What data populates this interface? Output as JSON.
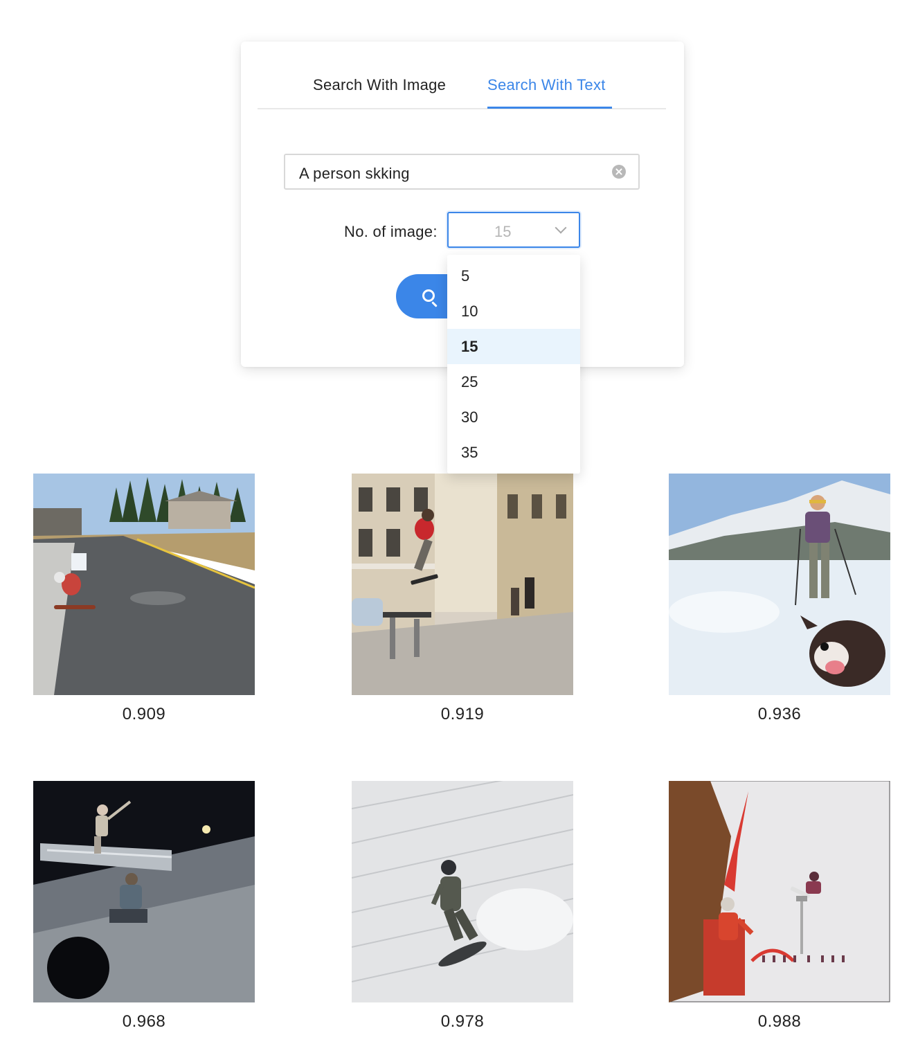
{
  "tabs": [
    {
      "label": "Search With Image",
      "active": false
    },
    {
      "label": "Search With Text",
      "active": true
    }
  ],
  "search": {
    "value": "A person skking"
  },
  "image_count": {
    "label": "No. of image:",
    "selected": "15",
    "options": [
      "5",
      "10",
      "15",
      "25",
      "30",
      "35"
    ]
  },
  "results": [
    {
      "score": "0.909",
      "scene": "longboarder on mountain road"
    },
    {
      "score": "0.919",
      "scene": "skateboarder grinding rail on city street"
    },
    {
      "score": "0.936",
      "scene": "skier with dog in snow"
    },
    {
      "score": "0.968",
      "scene": "snowboarder on rail at night"
    },
    {
      "score": "0.978",
      "scene": "snowboarder carving on slope"
    },
    {
      "score": "0.988",
      "scene": "snowboarder jumping with spectators"
    }
  ],
  "colors": {
    "accent": "#3b86e8",
    "selected_bg": "#e9f4fd"
  }
}
